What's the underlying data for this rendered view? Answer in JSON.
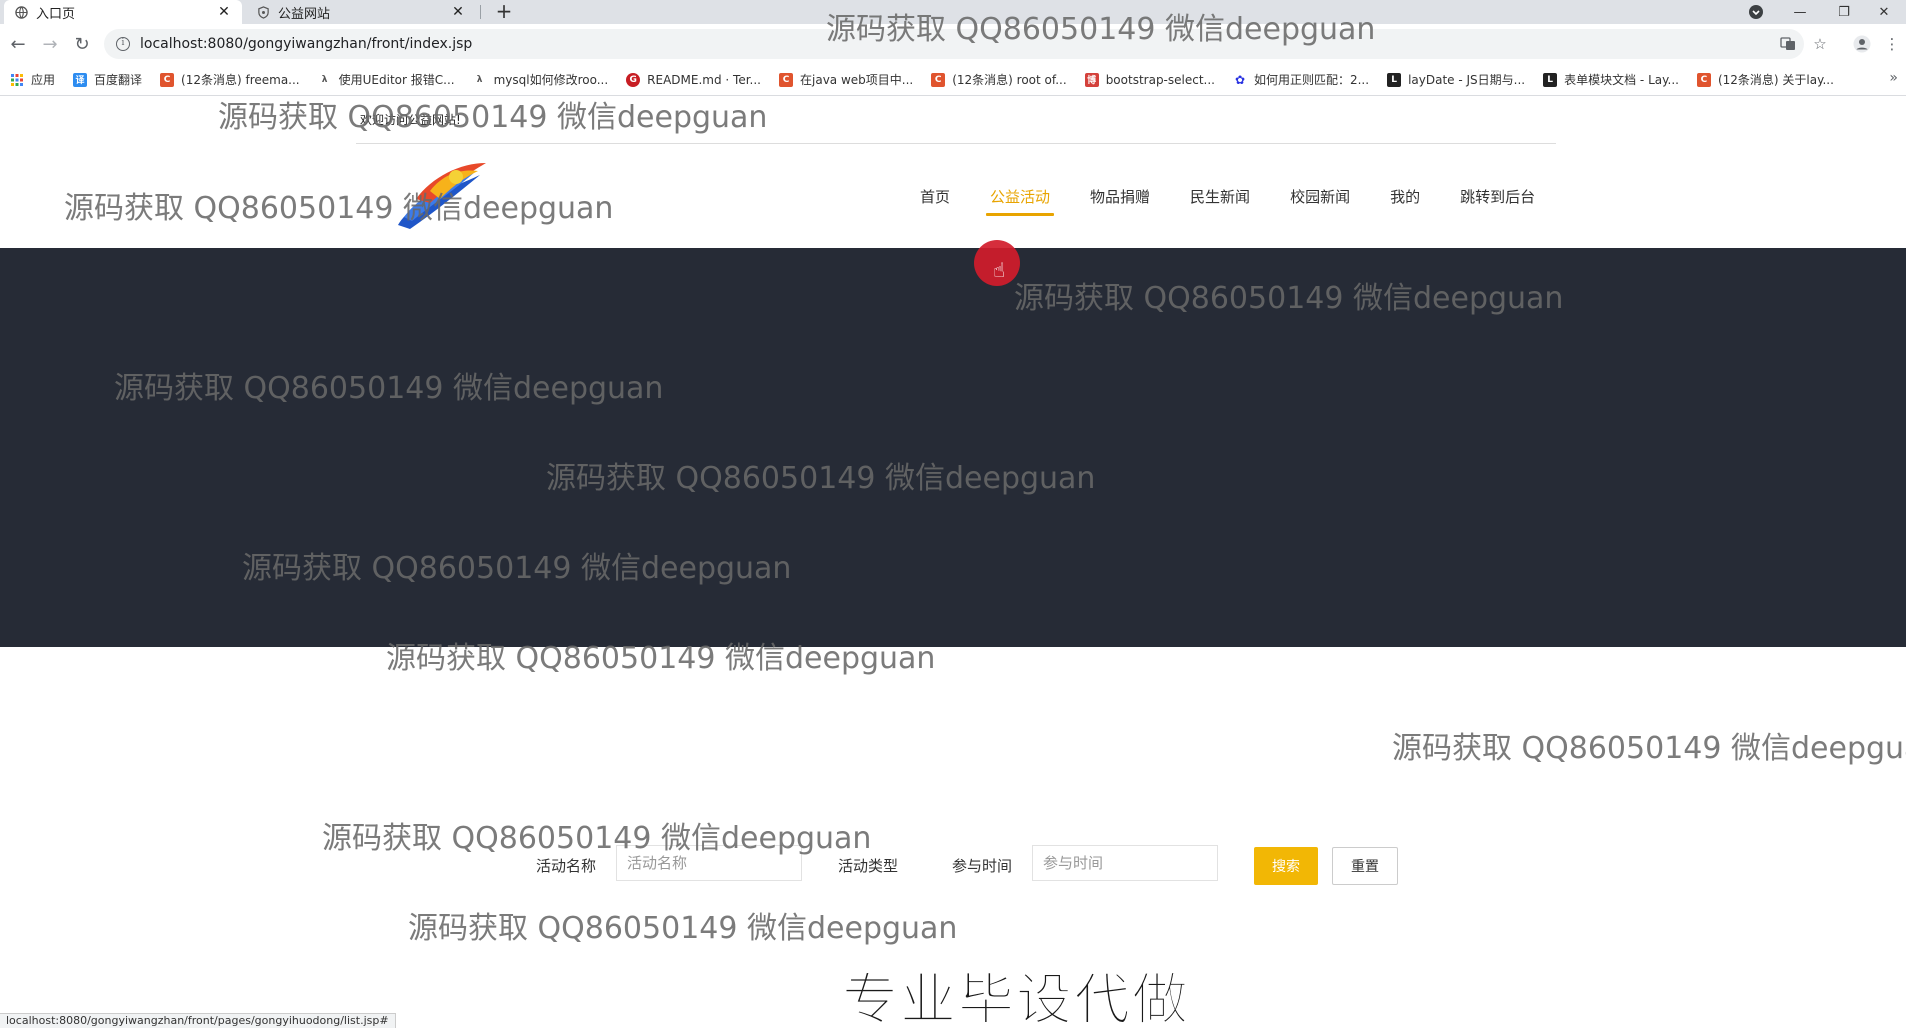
{
  "browser": {
    "tabs": [
      {
        "title": "入口页",
        "active": true
      },
      {
        "title": "公益网站",
        "active": false
      }
    ],
    "url": "localhost:8080/gongyiwangzhan/front/index.jsp",
    "bookmarks": [
      {
        "label": "应用",
        "icon": "apps-grid-icon",
        "color": "#4285f4"
      },
      {
        "label": "百度翻译",
        "icon": "translate-icon",
        "color": "#2d8cf0"
      },
      {
        "label": "(12条消息) freema...",
        "icon": "csdn-icon",
        "color": "#e0542e"
      },
      {
        "label": "使用UEditor 报错C...",
        "icon": "lambda-icon",
        "color": "#555555"
      },
      {
        "label": "mysql如何修改roo...",
        "icon": "lambda-icon",
        "color": "#555555"
      },
      {
        "label": "README.md · Ter...",
        "icon": "gitee-icon",
        "color": "#c71d23"
      },
      {
        "label": "在java web项目中...",
        "icon": "csdn-icon",
        "color": "#e0542e"
      },
      {
        "label": "(12条消息) root of...",
        "icon": "csdn-icon",
        "color": "#e0542e"
      },
      {
        "label": "bootstrap-select...",
        "icon": "cnblogs-icon",
        "color": "#d4413b"
      },
      {
        "label": "如何用正则匹配：2...",
        "icon": "baidu-paw-icon",
        "color": "#2932e1"
      },
      {
        "label": "layDate - JS日期与...",
        "icon": "layui-icon",
        "color": "#222222"
      },
      {
        "label": "表单模块文档 - Lay...",
        "icon": "layui-icon",
        "color": "#222222"
      },
      {
        "label": "(12条消息) 关于lay...",
        "icon": "csdn-icon",
        "color": "#e0542e"
      }
    ],
    "status_url": "localhost:8080/gongyiwangzhan/front/pages/gongyihuodong/list.jsp#"
  },
  "site": {
    "welcome": "欢迎访问公益网站!",
    "nav": [
      {
        "label": "首页",
        "active": false
      },
      {
        "label": "公益活动",
        "active": true
      },
      {
        "label": "物品捐赠",
        "active": false
      },
      {
        "label": "民生新闻",
        "active": false
      },
      {
        "label": "校园新闻",
        "active": false
      },
      {
        "label": "我的",
        "active": false
      },
      {
        "label": "跳转到后台",
        "active": false
      }
    ],
    "accent_color": "#e8a400",
    "banner_color": "#262b36"
  },
  "search": {
    "name_label": "活动名称",
    "name_placeholder": "活动名称",
    "type_label": "活动类型",
    "time_label": "参与时间",
    "time_placeholder": "参与时间",
    "search_button": "搜索",
    "reset_button": "重置"
  },
  "overlay": {
    "watermark": "源码获取 QQ86050149 微信deepguan",
    "watermark_partial": "源码获取 QQ86050149 微信deepgua",
    "promo": "专业毕设代做"
  }
}
